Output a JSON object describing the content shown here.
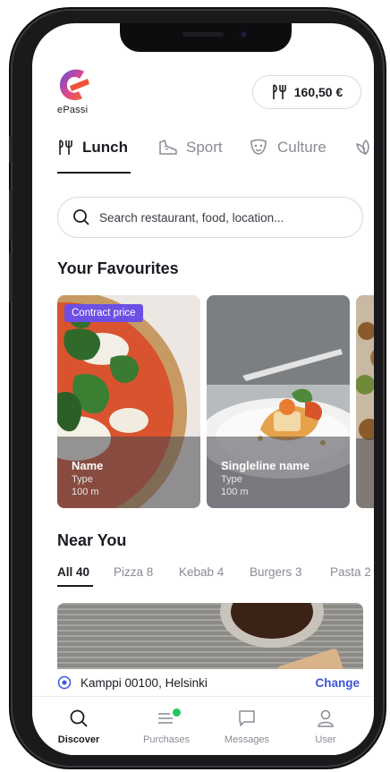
{
  "app": {
    "logo_text": "ePassi",
    "balance": "160,50 €"
  },
  "category_tabs": [
    {
      "label": "Lunch",
      "icon": "fork-knife-icon",
      "active": true
    },
    {
      "label": "Sport",
      "icon": "sport-shoe-icon",
      "active": false
    },
    {
      "label": "Culture",
      "icon": "theater-mask-icon",
      "active": false
    },
    {
      "label": "",
      "icon": "lotus-icon",
      "active": false
    }
  ],
  "search": {
    "placeholder": "Search restaurant, food, location..."
  },
  "favourites": {
    "title": "Your Favourites",
    "cards": [
      {
        "badge": "Contract price",
        "name": "Name",
        "type": "Type",
        "distance": "100 m",
        "image": "pizza"
      },
      {
        "name": "Singleline name",
        "type": "Type",
        "distance": "100 m",
        "image": "plated-dish"
      },
      {
        "name": "",
        "type": "",
        "distance": "",
        "image": "salad"
      }
    ]
  },
  "near_you": {
    "title": "Near You",
    "filters": [
      {
        "label": "All 40",
        "active": true
      },
      {
        "label": "Pizza 8",
        "active": false
      },
      {
        "label": "Kebab 4",
        "active": false
      },
      {
        "label": "Burgers 3",
        "active": false
      },
      {
        "label": "Pasta 2",
        "active": false
      }
    ]
  },
  "location": {
    "address": "Kamppi 00100, Helsinki",
    "action": "Change"
  },
  "bottom_nav": [
    {
      "label": "Discover",
      "icon": "search-icon",
      "active": true
    },
    {
      "label": "Purchases",
      "icon": "list-icon",
      "active": false,
      "badge_color": "#23c55e"
    },
    {
      "label": "Messages",
      "icon": "chat-bubble-icon",
      "active": false
    },
    {
      "label": "User",
      "icon": "user-icon",
      "active": false
    }
  ],
  "colors": {
    "accent_purple": "#6d4fe3",
    "link_blue": "#3b56d9",
    "badge_green": "#23c55e",
    "logo_orange": "#f0533a"
  }
}
